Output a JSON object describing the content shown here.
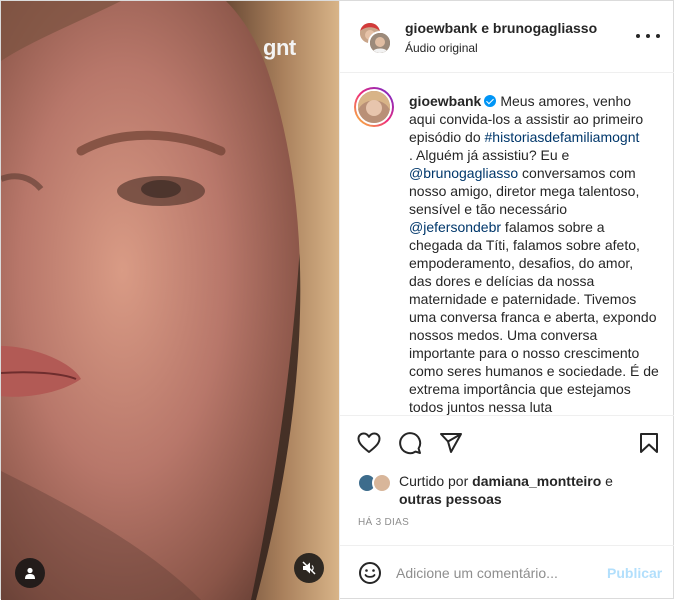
{
  "media": {
    "brand": "gnt",
    "user_tag_icon": "user-icon",
    "mute_icon": "speaker-muted-icon"
  },
  "header": {
    "title": "gioewbank e brunogagliasso",
    "subtitle": "Áudio original",
    "more_icon": "more-horizontal-icon"
  },
  "caption": {
    "username": "gioewbank",
    "parts": {
      "p1": "Meus amores, venho aqui convida-los a assistir ao primeiro episódio do ",
      "hashtag": "#historiasdefamiliamognt",
      "p2": "\n. Alguém já assistiu? Eu e ",
      "mention1": "@brunogagliasso",
      "p3": " conversamos com nosso amigo, diretor mega talentoso, sensível e tão necessário ",
      "mention2": "@jefersondebr",
      "p4": " falamos sobre a chegada da Títi, falamos sobre afeto, empoderamento, desafios, do amor, das dores e delícias da nossa maternidade e paternidade. Tivemos uma conversa franca e aberta, expondo nossos medos. Uma conversa importante para o nosso crescimento como seres humanos e sociedade. É de extrema importância que estejamos todos juntos nessa luta"
    }
  },
  "actions": {
    "like_icon": "heart-icon",
    "comment_icon": "comment-icon",
    "share_icon": "paper-plane-icon",
    "save_icon": "bookmark-icon"
  },
  "likes": {
    "prefix": "Curtido por ",
    "user": "damiana_montteiro",
    "middle": " e ",
    "others": "outras pessoas"
  },
  "time": "HÁ 3 DIAS",
  "comment": {
    "placeholder": "Adicione um comentário...",
    "post_label": "Publicar",
    "emoji_icon": "smiley-icon"
  },
  "colors": {
    "link": "#00376b",
    "publish_disabled": "#b2dffc",
    "verified": "#0095f6",
    "secondary_text": "#8e8e8e"
  }
}
